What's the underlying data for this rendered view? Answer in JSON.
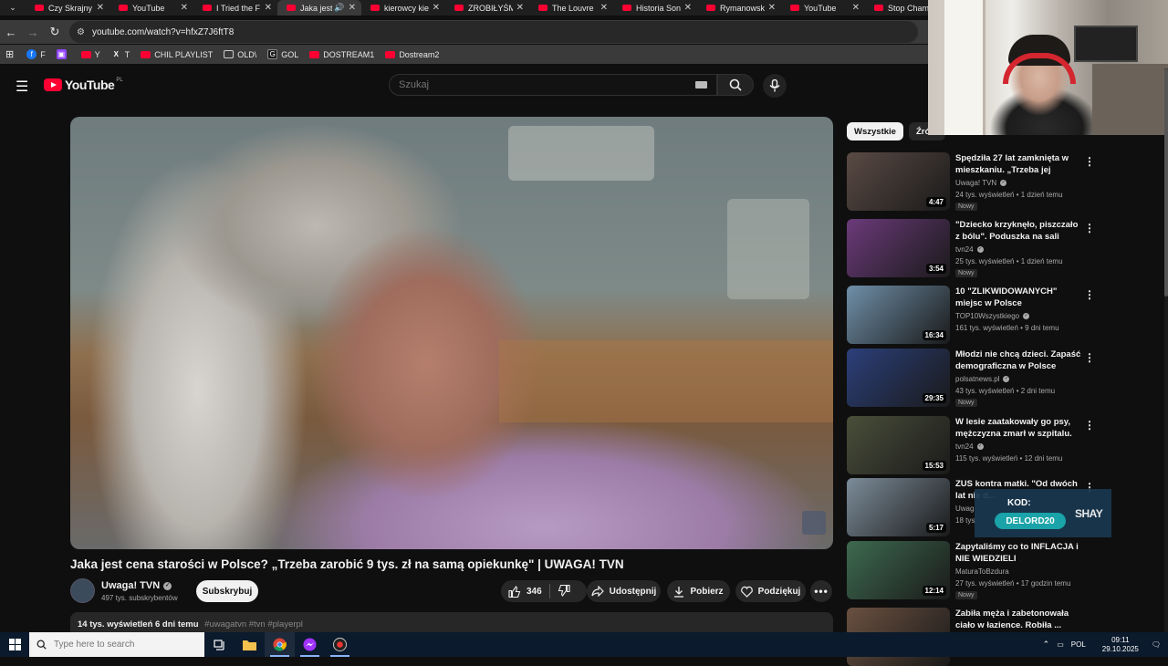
{
  "browser": {
    "tabs": [
      {
        "title": "Czy Skrajny",
        "active": false
      },
      {
        "title": "YouTube",
        "active": false
      },
      {
        "title": "I Tried the F",
        "active": false
      },
      {
        "title": "Jaka jest",
        "active": true
      },
      {
        "title": "kierowcy kie",
        "active": false
      },
      {
        "title": "ZROBIŁYŚM",
        "active": false
      },
      {
        "title": "The Louvre",
        "active": false
      },
      {
        "title": "Historia Son",
        "active": false
      },
      {
        "title": "Rymanowsk",
        "active": false
      },
      {
        "title": "YouTube",
        "active": false
      },
      {
        "title": "Stop Cham",
        "active": false
      }
    ],
    "url": "youtube.com/watch?v=hfxZ7J6ftT8",
    "bookmarks": [
      {
        "label": "F",
        "icon": "facebook-icon"
      },
      {
        "label": "",
        "icon": "twitch-icon"
      },
      {
        "label": "Y",
        "icon": "youtube-icon"
      },
      {
        "label": "T",
        "icon": "x-icon"
      },
      {
        "label": "CHIL PLAYLIST",
        "icon": "youtube-icon"
      },
      {
        "label": "OLD\\",
        "icon": "folder-icon"
      },
      {
        "label": "GOL",
        "icon": "gol-icon"
      },
      {
        "label": "DOSTREAM1",
        "icon": "youtube-icon"
      },
      {
        "label": "Dostream2",
        "icon": "youtube-icon"
      }
    ]
  },
  "youtube": {
    "logo_text": "YouTube",
    "region": "PL",
    "search_placeholder": "Szukaj"
  },
  "video": {
    "title": "Jaka jest cena starości w Polsce? „Trzeba zarobić 9 tys. zł na samą opiekunkę\" | UWAGA! TVN",
    "channel": "Uwaga! TVN",
    "subscribers": "497 tys. subskrybentów",
    "subscribe_label": "Subskrybuj",
    "likes": "346",
    "share_label": "Udostępnij",
    "download_label": "Pobierz",
    "thanks_label": "Podziękuj",
    "stats": "14 tys. wyświetleń  6 dni temu",
    "hashtags": "#uwagatvn #tvn #playerpl"
  },
  "chips": {
    "all": "Wszystkie",
    "source": "Źródło"
  },
  "recommendations": [
    {
      "title": "Spędziła 27 lat zamknięta w mieszkaniu. „Trzeba jej pomóc...",
      "channel": "Uwaga! TVN",
      "verified": true,
      "meta": "24 tys. wyświetleń • 1 dzień temu",
      "badge": "Nowy",
      "duration": "4:47",
      "thumb_color": "#5a4a44"
    },
    {
      "title": "\"Dziecko krzyknęło, piszczało z bólu\". Poduszka na sali zabaw...",
      "channel": "tvn24",
      "verified": true,
      "meta": "25 tys. wyświetleń • 1 dzień temu",
      "badge": "Nowy",
      "duration": "3:54",
      "thumb_color": "#6b3a7a"
    },
    {
      "title": "10 \"ZLIKWIDOWANYCH\" miejsc w Polsce",
      "channel": "TOP10Wszystkiego",
      "verified": true,
      "meta": "161 tys. wyświetleń • 9 dni temu",
      "badge": "",
      "duration": "16:34",
      "thumb_color": "#6f8fa8"
    },
    {
      "title": "Młodzi nie chcą dzieci. Zapaść demograficzna w Polsce",
      "channel": "polsatnews.pl",
      "verified": true,
      "meta": "43 tys. wyświetleń • 2 dni temu",
      "badge": "Nowy",
      "duration": "29:35",
      "thumb_color": "#2b3f7a"
    },
    {
      "title": "W lesie zaatakowały go psy, mężczyzna zmarł w szpitalu. ...",
      "channel": "tvn24",
      "verified": true,
      "meta": "115 tys. wyświetleń • 12 dni temu",
      "badge": "",
      "duration": "15:53",
      "thumb_color": "#4a4f3a"
    },
    {
      "title": "ZUS kontra matki. \"Od dwóch lat nie d...",
      "channel": "Uwag...",
      "verified": false,
      "meta": "18 tys...",
      "badge": "",
      "duration": "5:17",
      "thumb_color": "#7c8c99"
    },
    {
      "title": "Zapytaliśmy co to INFLACJA i NIE WIEDZIELI",
      "channel": "MaturaToBzdura",
      "verified": false,
      "meta": "27 tys. wyświetleń • 17 godzin temu",
      "badge": "Nowy",
      "duration": "12:14",
      "thumb_color": "#3d6a4f"
    },
    {
      "title": "Zabiła męża i zabetonowała ciało w łazience. Robiła ...",
      "channel": "",
      "verified": false,
      "meta": "",
      "badge": "",
      "duration": "",
      "thumb_color": "#6a5040"
    }
  ],
  "sponsor": {
    "label": "KOD:",
    "code": "DELORD20",
    "brand": "SHAY"
  },
  "taskbar": {
    "search_placeholder": "Type here to search",
    "lang": "POL",
    "time": "09:11",
    "date": "29.10.2025"
  }
}
